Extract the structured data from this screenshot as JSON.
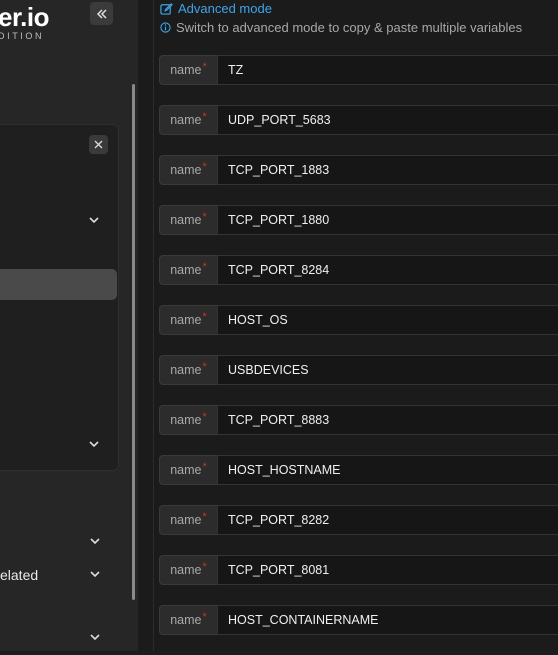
{
  "sidebar": {
    "logo_main": "er.io",
    "logo_sub": "DITION",
    "collapse_icon": "double-chevron-left-icon",
    "related_label": "elated"
  },
  "main": {
    "advanced_mode_label": "Advanced mode",
    "advanced_mode_hint": "Switch to advanced mode to copy & paste multiple variables",
    "env_vars": [
      {
        "label": "name",
        "required_mark": "*",
        "value": "TZ"
      },
      {
        "label": "name",
        "required_mark": "*",
        "value": "UDP_PORT_5683"
      },
      {
        "label": "name",
        "required_mark": "*",
        "value": "TCP_PORT_1883"
      },
      {
        "label": "name",
        "required_mark": "*",
        "value": "TCP_PORT_1880"
      },
      {
        "label": "name",
        "required_mark": "*",
        "value": "TCP_PORT_8284"
      },
      {
        "label": "name",
        "required_mark": "*",
        "value": "HOST_OS"
      },
      {
        "label": "name",
        "required_mark": "*",
        "value": "USBDEVICES"
      },
      {
        "label": "name",
        "required_mark": "*",
        "value": "TCP_PORT_8883"
      },
      {
        "label": "name",
        "required_mark": "*",
        "value": "HOST_HOSTNAME"
      },
      {
        "label": "name",
        "required_mark": "*",
        "value": "TCP_PORT_8282"
      },
      {
        "label": "name",
        "required_mark": "*",
        "value": "TCP_PORT_8081"
      },
      {
        "label": "name",
        "required_mark": "*",
        "value": "HOST_CONTAINERNAME"
      }
    ]
  },
  "colors": {
    "accent": "#3ea5e8",
    "required": "#c0392b",
    "sidebar_bg": "#262626",
    "main_bg": "#1b1b1b"
  }
}
